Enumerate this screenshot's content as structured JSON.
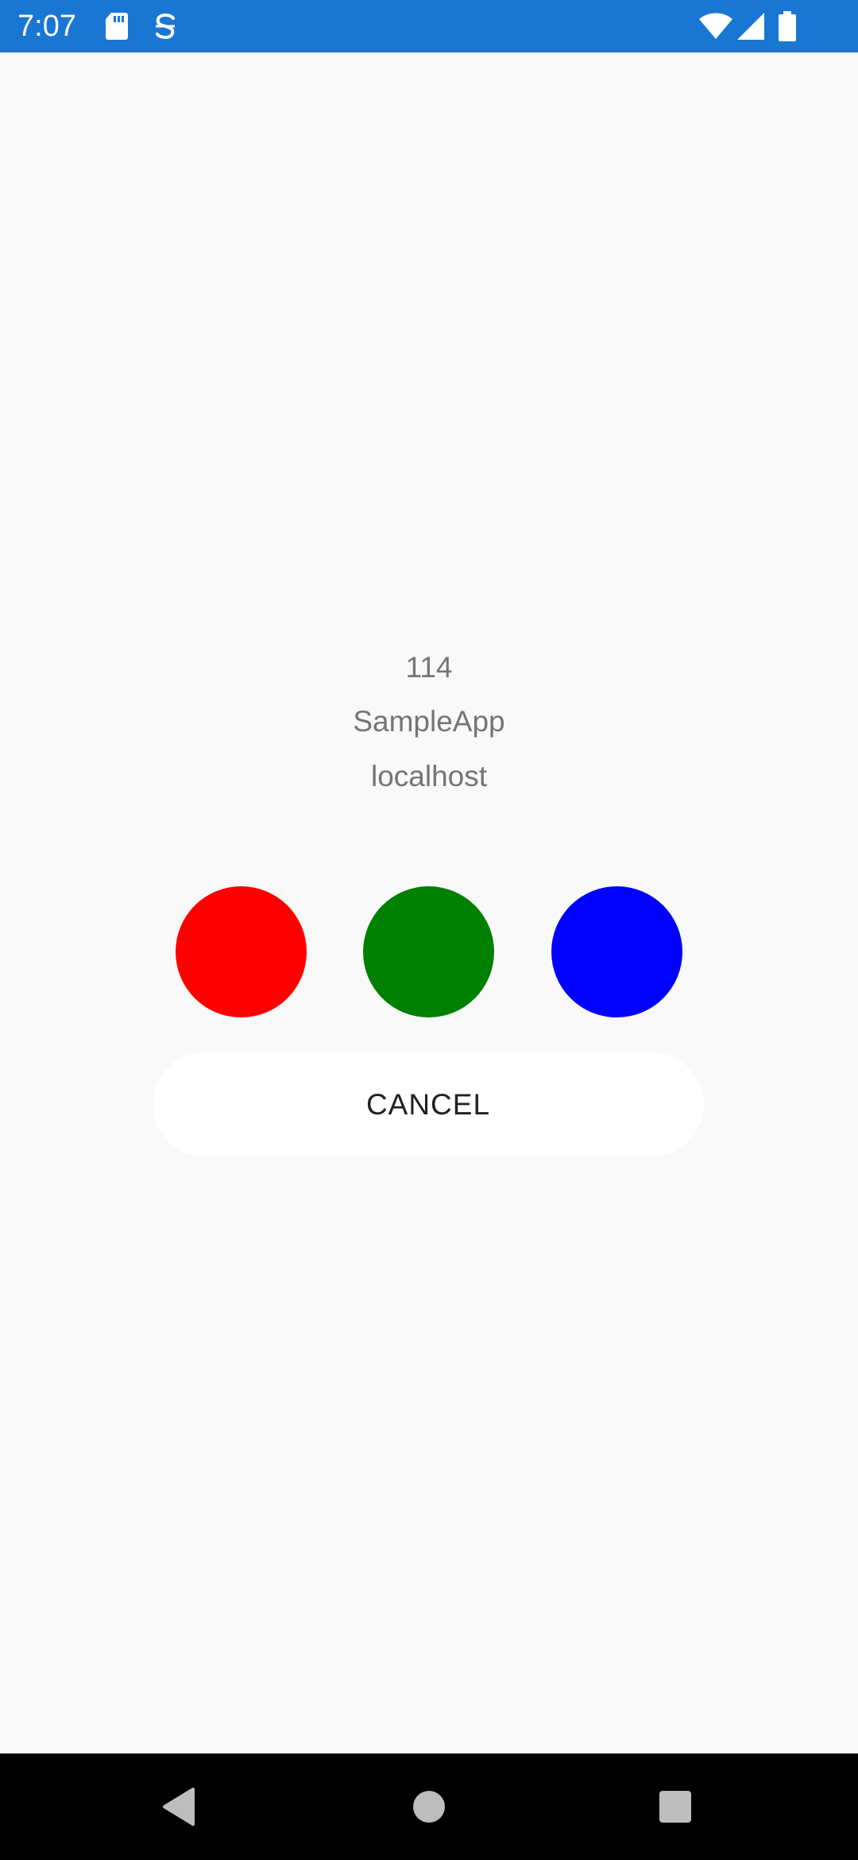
{
  "status_bar": {
    "time": "7:07",
    "color": "#1976d2",
    "icons": [
      "sd-card-icon",
      "sync-icon",
      "wifi-icon",
      "signal-icon",
      "battery-icon"
    ]
  },
  "main": {
    "lines": [
      "114",
      "SampleApp",
      "localhost"
    ],
    "circles": [
      {
        "name": "red-circle",
        "color": "#ff0000"
      },
      {
        "name": "green-circle",
        "color": "#008000"
      },
      {
        "name": "blue-circle",
        "color": "#0000ff"
      }
    ],
    "cancel_label": "CANCEL"
  },
  "nav_bar": {
    "icons": [
      "back-icon",
      "home-icon",
      "recents-icon"
    ]
  }
}
